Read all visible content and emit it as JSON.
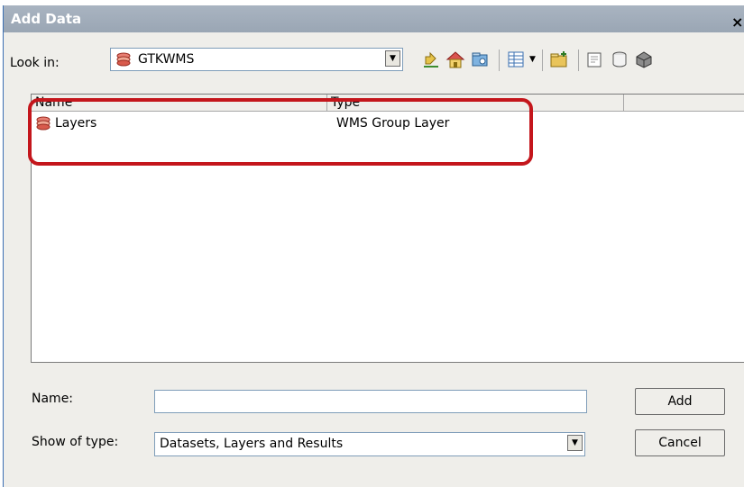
{
  "window": {
    "title": "Add Data",
    "close_label": "×"
  },
  "toolbar": {
    "look_in_label": "Look in:",
    "look_in_value": "GTKWMS",
    "buttons": [
      "up-one-level-icon",
      "home-icon",
      "connect-to-folder-icon",
      "view-options-icon",
      "new-folder-icon",
      "new-shapefile-icon",
      "new-geodatabase-icon",
      "catalog-icon"
    ]
  },
  "list": {
    "columns": [
      "Name",
      "Type"
    ],
    "rows": [
      {
        "name": "Layers",
        "type": "WMS Group Layer",
        "icon": "layers-icon"
      }
    ]
  },
  "footer": {
    "name_label": "Name:",
    "name_value": "",
    "show_type_label": "Show of type:",
    "show_type_value": "Datasets, Layers and Results",
    "add_label": "Add",
    "cancel_label": "Cancel"
  },
  "colors": {
    "highlight": "#c4161c",
    "titlebar": "#a3afbd"
  }
}
